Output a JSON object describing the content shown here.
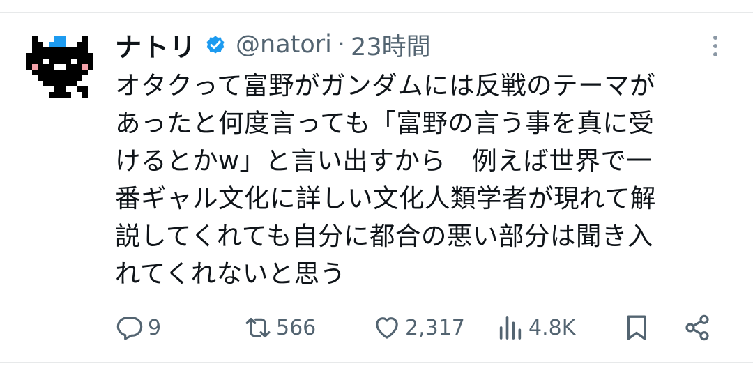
{
  "tweet": {
    "author": {
      "display_name": "ナトリ",
      "handle": "@natori",
      "verified": true,
      "avatar_icon": "pixel-cat-avatar"
    },
    "separator": "·",
    "time": "23時間",
    "more_icon": "more-vertical-icon",
    "text_lines": [
      "オタクって富野がガンダムには反戦のテーマが",
      "あったと何度言っても「富野の言う事を真に受",
      "けるとかw」と言い出すから　例えば世界で一",
      "番ギャル文化に詳しい文化人類学者が現れて解",
      "説してくれても自分に都合の悪い部分は聞き入",
      "れてくれないと思う"
    ],
    "actions": {
      "reply": {
        "icon": "reply-icon",
        "count": "9"
      },
      "retweet": {
        "icon": "retweet-icon",
        "count": "566"
      },
      "like": {
        "icon": "heart-icon",
        "count": "2,317"
      },
      "views": {
        "icon": "views-icon",
        "count": "4.8K"
      },
      "bookmark": {
        "icon": "bookmark-icon"
      },
      "share": {
        "icon": "share-icon"
      }
    }
  },
  "colors": {
    "text": "#0f1419",
    "secondary": "#536471",
    "verified_blue": "#1d9bf0",
    "divider": "#e7e9ea"
  }
}
